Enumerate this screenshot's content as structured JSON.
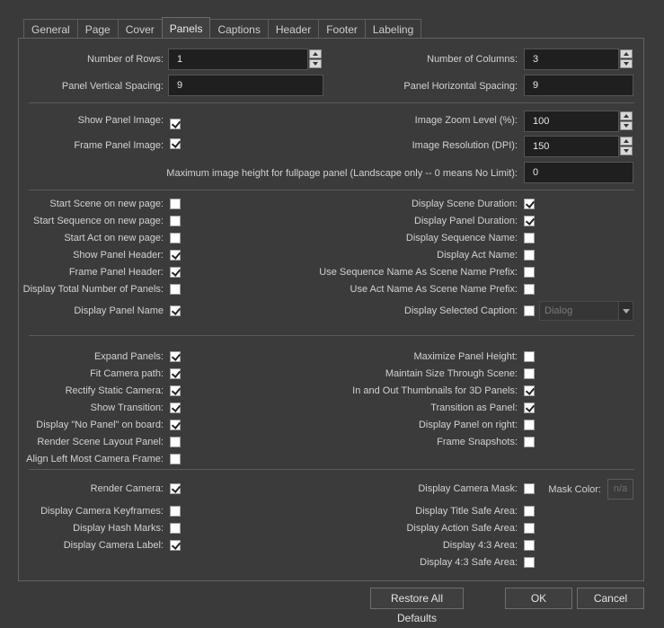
{
  "tabs": [
    "General",
    "Page",
    "Cover",
    "Panels",
    "Captions",
    "Header",
    "Footer",
    "Labeling"
  ],
  "fields": {
    "rows_label": "Number of Rows:",
    "rows_value": "1",
    "cols_label": "Number of Columns:",
    "cols_value": "3",
    "vspace_label": "Panel Vertical Spacing:",
    "vspace_value": "9",
    "hspace_label": "Panel Horizontal Spacing:",
    "hspace_value": "9",
    "show_image_label": "Show Panel Image:",
    "frame_image_label": "Frame Panel Image:",
    "zoom_label": "Image Zoom Level (%):",
    "zoom_value": "100",
    "res_label": "Image Resolution (DPI):",
    "res_value": "150",
    "maxh_label": "Maximum image height for fullpage panel (Landscape only -- 0 means No Limit):",
    "maxh_value": "0"
  },
  "left_group1": [
    {
      "label": "Start Scene on new page:",
      "checked": false
    },
    {
      "label": "Start Sequence on new page:",
      "checked": false
    },
    {
      "label": "Start Act on new page:",
      "checked": false
    },
    {
      "label": "Show Panel Header:",
      "checked": true
    },
    {
      "label": "Frame Panel Header:",
      "checked": true
    },
    {
      "label": "Display Total Number of Panels:",
      "checked": false
    },
    {
      "label": "Display Panel Name",
      "checked": true
    }
  ],
  "right_group1": [
    {
      "label": "Display Scene Duration:",
      "checked": true
    },
    {
      "label": "Display Panel Duration:",
      "checked": true
    },
    {
      "label": "Display Sequence Name:",
      "checked": false
    },
    {
      "label": "Display Act Name:",
      "checked": false
    },
    {
      "label": "Use Sequence Name As Scene Name Prefix:",
      "checked": false
    },
    {
      "label": "Use Act Name As Scene Name Prefix:",
      "checked": false
    },
    {
      "label": "Display Selected Caption:",
      "checked": false
    }
  ],
  "caption_combo": "Dialog",
  "left_group2": [
    {
      "label": "Expand Panels:",
      "checked": true
    },
    {
      "label": "Fit Camera path:",
      "checked": true
    },
    {
      "label": "Rectify Static Camera:",
      "checked": true
    },
    {
      "label": "Show Transition:",
      "checked": true
    },
    {
      "label": "Display \"No Panel\" on board:",
      "checked": true
    },
    {
      "label": "Render Scene Layout Panel:",
      "checked": false
    },
    {
      "label": "Align Left Most Camera Frame:",
      "checked": false
    }
  ],
  "right_group2": [
    {
      "label": "Maximize Panel Height:",
      "checked": false
    },
    {
      "label": "Maintain Size Through Scene:",
      "checked": false
    },
    {
      "label": "In and Out Thumbnails for 3D Panels:",
      "checked": true
    },
    {
      "label": "Transition as Panel:",
      "checked": true
    },
    {
      "label": "Display Panel on right:",
      "checked": false
    },
    {
      "label": "Frame Snapshots:",
      "checked": false
    }
  ],
  "left_group3": [
    {
      "label": "Render Camera:",
      "checked": true
    },
    {
      "label": "Display Camera Keyframes:",
      "checked": false
    },
    {
      "label": "Display Hash Marks:",
      "checked": false
    },
    {
      "label": "Display Camera Label:",
      "checked": true
    }
  ],
  "right_group3": [
    {
      "label": "Display Camera Mask:",
      "checked": false
    },
    {
      "label": "Display Title Safe Area:",
      "checked": false
    },
    {
      "label": "Display Action Safe Area:",
      "checked": false
    },
    {
      "label": "Display 4:3 Area:",
      "checked": false
    },
    {
      "label": "Display 4:3 Safe Area:",
      "checked": false
    }
  ],
  "mask_color_label": "Mask Color:",
  "mask_color_value": "n/a",
  "buttons": {
    "restore": "Restore All Defaults",
    "ok": "OK",
    "cancel": "Cancel"
  }
}
